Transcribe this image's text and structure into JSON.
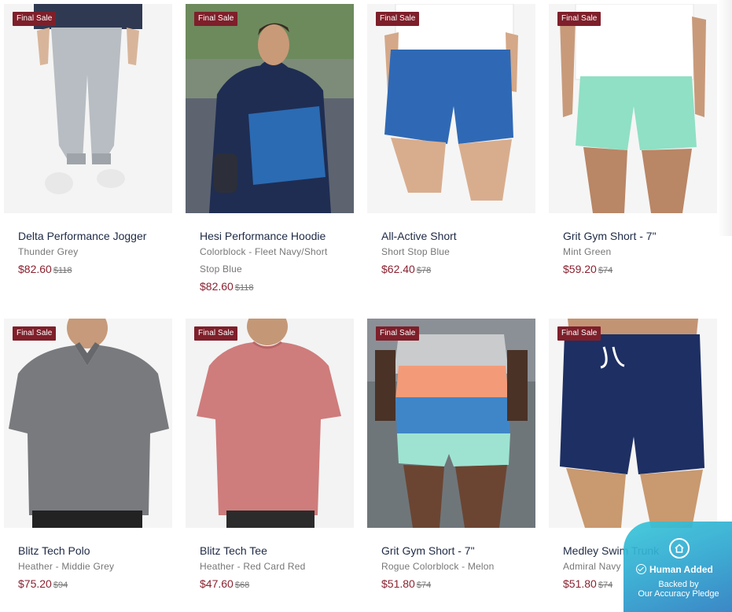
{
  "badge_label": "Final Sale",
  "products": [
    {
      "title": "Delta Performance Jogger",
      "variant": "Thunder Grey",
      "variant2": "",
      "price": "$82.60",
      "compare": "$118",
      "image": "model-grey-jogger"
    },
    {
      "title": "Hesi Performance Hoodie",
      "variant": "Colorblock - Fleet Navy/Short",
      "variant2": "Stop Blue",
      "price": "$82.60",
      "compare": "$118",
      "image": "model-navy-blue-hoodie"
    },
    {
      "title": "All-Active Short",
      "variant": "Short Stop Blue",
      "variant2": "",
      "price": "$62.40",
      "compare": "$78",
      "image": "model-blue-short"
    },
    {
      "title": "Grit Gym Short - 7\"",
      "variant": "Mint Green",
      "variant2": "",
      "price": "$59.20",
      "compare": "$74",
      "image": "model-mint-short"
    },
    {
      "title": "Blitz Tech Polo",
      "variant": "Heather - Middie Grey",
      "variant2": "",
      "price": "$75.20",
      "compare": "$94",
      "image": "model-grey-polo"
    },
    {
      "title": "Blitz Tech Tee",
      "variant": "Heather - Red Card Red",
      "variant2": "",
      "price": "$47.60",
      "compare": "$68",
      "image": "model-red-tee"
    },
    {
      "title": "Grit Gym Short - 7\"",
      "variant": "Rogue Colorblock - Melon",
      "variant2": "",
      "price": "$51.80",
      "compare": "$74",
      "image": "model-colorblock-short"
    },
    {
      "title": "Medley Swim Trunk",
      "variant": "Admiral Navy",
      "variant2": "",
      "price": "$51.80",
      "compare": "$74",
      "image": "model-navy-swim-trunk"
    }
  ],
  "widget": {
    "human_added": "Human Added",
    "backed_by": "Backed by",
    "pledge": "Our Accuracy Pledge",
    "icon": "home-icon"
  },
  "colors": {
    "badge": "#7e1f2a",
    "price": "#8a2230",
    "title": "#1e2a45"
  }
}
